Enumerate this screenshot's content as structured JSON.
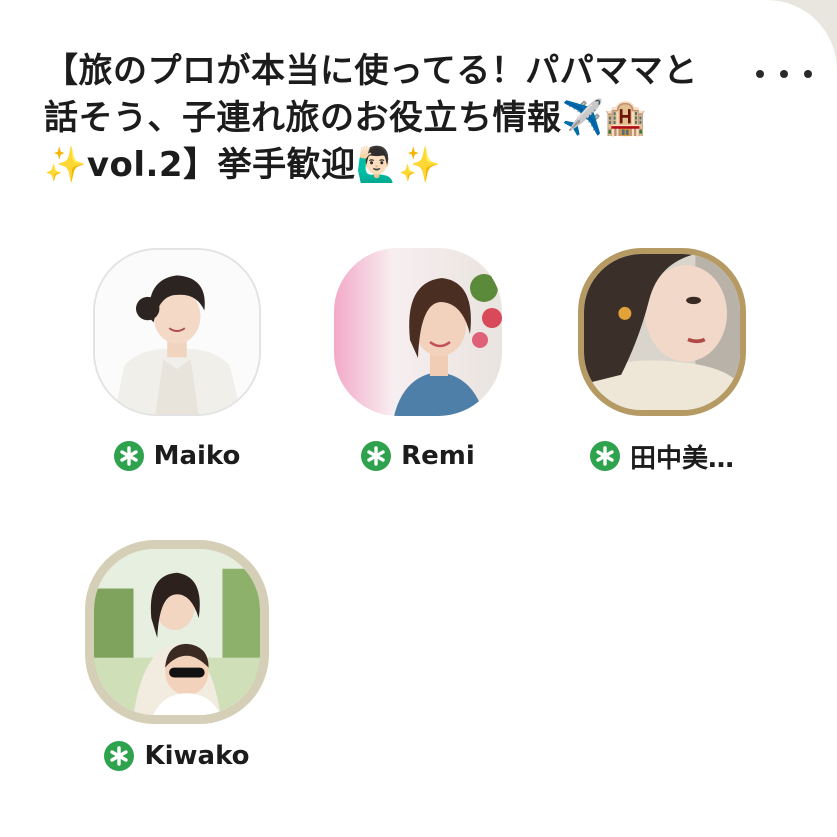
{
  "room": {
    "title": "【旅のプロが本当に使ってる！パパママと話そう、子連れ旅のお役立ち情報✈️🏨✨vol.2】挙手歓迎🙋🏻‍♂️✨"
  },
  "speakers": [
    {
      "name": "Maiko",
      "moderator": true,
      "avatar_icon": "portrait-woman-white-jacket"
    },
    {
      "name": "Remi",
      "moderator": true,
      "avatar_icon": "portrait-woman-flowers"
    },
    {
      "name": "田中美…",
      "moderator": true,
      "avatar_icon": "portrait-woman-closeup"
    },
    {
      "name": "Kiwako",
      "moderator": true,
      "avatar_icon": "portrait-woman-with-child"
    }
  ],
  "colors": {
    "moderator_badge": "#2fa24e",
    "text": "#1c1c1c",
    "avatar_ring": "#c9c2ad"
  }
}
